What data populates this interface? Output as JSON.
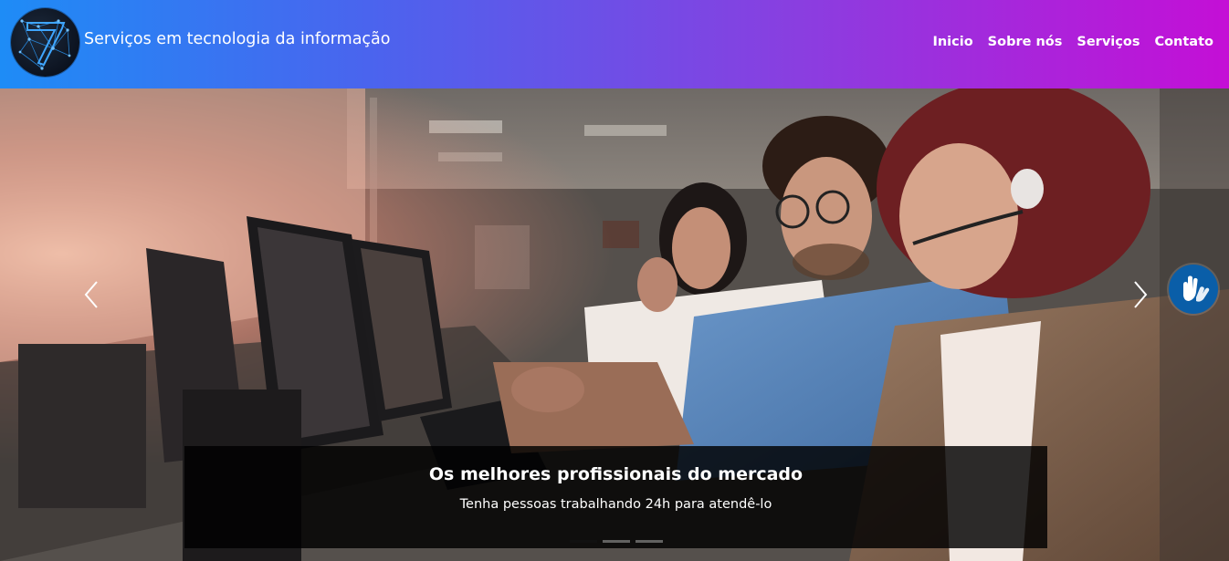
{
  "brand": {
    "name": "Serviços em tecnologia da informação",
    "logo_icon": "network-7-logo"
  },
  "nav": {
    "items": [
      {
        "label": "Inicio"
      },
      {
        "label": "Sobre nós"
      },
      {
        "label": "Serviços"
      },
      {
        "label": "Contato"
      }
    ]
  },
  "carousel": {
    "slide": {
      "title": "Os melhores profissionais do mercado",
      "text": "Tenha pessoas trabalhando 24h para atendê-lo",
      "image": "team-at-computers-photo"
    },
    "prev_icon": "chevron-left-icon",
    "next_icon": "chevron-right-icon",
    "active_index": 0,
    "slides_count": 3
  },
  "accessibility": {
    "icon": "sign-language-hands-icon",
    "color": "#0a5ea8"
  },
  "colors": {
    "header_gradient_start": "#1e8cf6",
    "header_gradient_end": "#c40fd6"
  }
}
